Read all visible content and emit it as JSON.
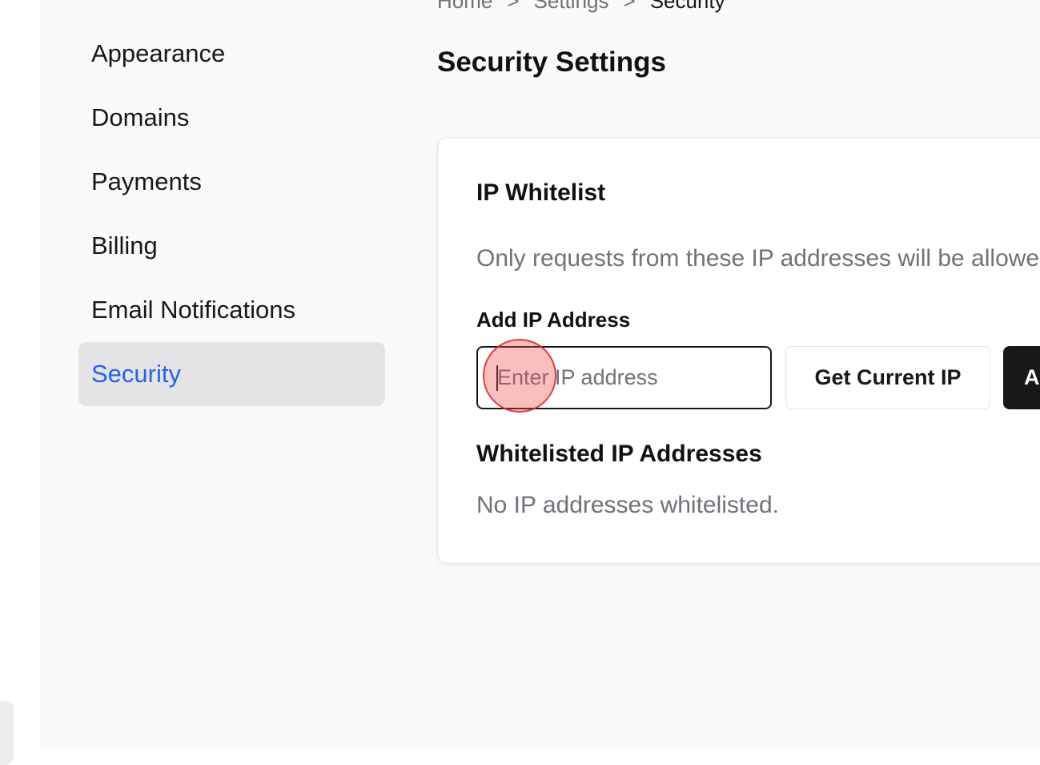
{
  "sidebar": {
    "items": [
      {
        "label": "Appearance"
      },
      {
        "label": "Domains"
      },
      {
        "label": "Payments"
      },
      {
        "label": "Billing"
      },
      {
        "label": "Email Notifications"
      },
      {
        "label": "Security",
        "active": true
      }
    ]
  },
  "breadcrumb": {
    "items": [
      "Home",
      "Settings",
      "Security"
    ],
    "separator": ">"
  },
  "page": {
    "title": "Security Settings"
  },
  "card": {
    "title": "IP Whitelist",
    "description": "Only requests from these IP addresses will be allowed",
    "add_label": "Add IP Address",
    "input": {
      "placeholder": "Enter IP address",
      "value": ""
    },
    "get_current_ip_label": "Get Current IP",
    "add_button_label": "Add",
    "list_title": "Whitelisted IP Addresses",
    "empty_text": "No IP addresses whitelisted."
  },
  "colors": {
    "accent": "#2563eb",
    "primary_button": "#18181b",
    "active_item_bg": "#e4e4e7",
    "muted_text": "#71717a"
  }
}
